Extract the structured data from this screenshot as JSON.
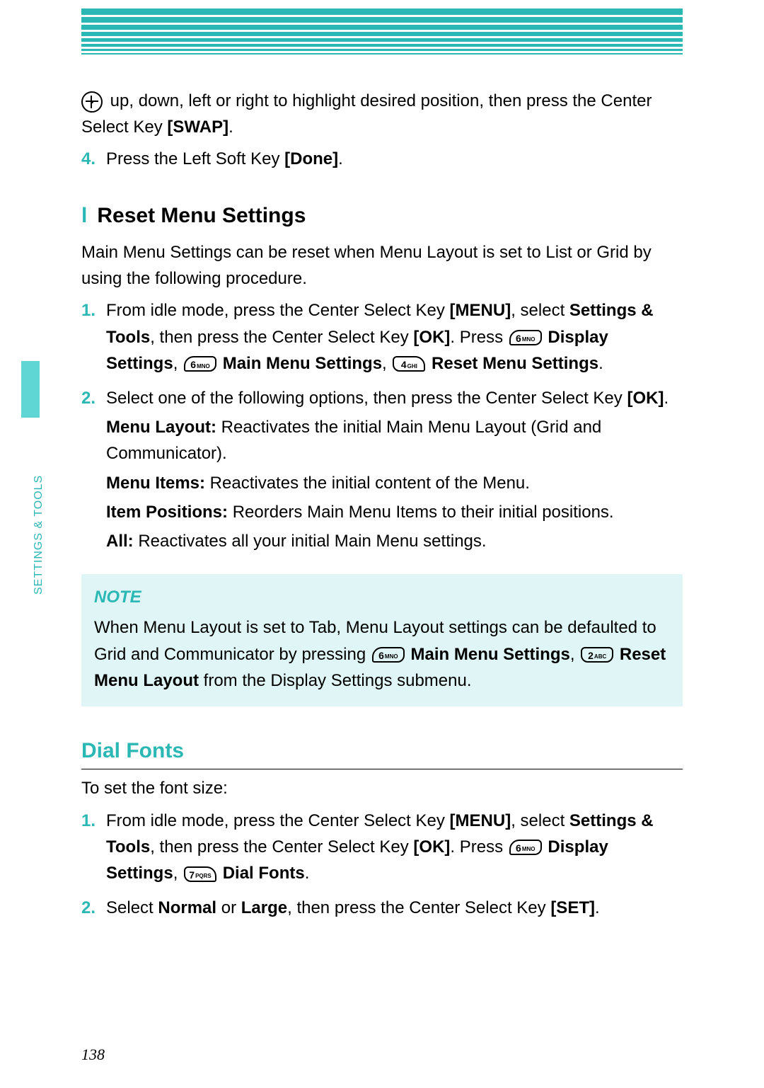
{
  "sideTab": "SETTINGS & TOOLS",
  "pageNumber": "138",
  "intro": {
    "line1a": " up, down, left or right to highlight desired position, then press the Center Select Key ",
    "swap": "[SWAP]",
    "period1": ".",
    "step4num": "4.",
    "step4a": " Press the Left Soft Key ",
    "done": "[Done]",
    "period2": "."
  },
  "reset": {
    "heading": "Reset Menu Settings",
    "intro": "Main Menu Settings can be reset when Menu Layout is set to List or Grid by using the following procedure.",
    "s1num": "1.",
    "s1a": " From idle mode, press the Center Select Key ",
    "menu": "[MENU]",
    "s1b": ", select ",
    "settingsTools": "Settings & Tools",
    "s1c": ", then press the Center Select Key ",
    "ok": "[OK]",
    "s1d": ". Press ",
    "displaySettings": " Display Settings",
    "comma": ", ",
    "mainMenuSettings": " Main Menu Settings",
    "resetMenuSettings": " Reset Menu Settings",
    "period": ".",
    "s2num": "2.",
    "s2a": " Select one of the following options, then press the Center Select Key ",
    "menuLayoutLabel": "Menu Layout:",
    "menuLayoutText": " Reactivates the initial Main Menu Layout (Grid and Communicator).",
    "menuItemsLabel": "Menu Items:",
    "menuItemsText": " Reactivates the initial content of the Menu.",
    "itemPositionsLabel": "Item Positions:",
    "itemPositionsText": " Reorders Main Menu Items to their initial positions.",
    "allLabel": "All:",
    "allText": " Reactivates all your initial Main Menu settings."
  },
  "note": {
    "title": "NOTE",
    "t1": "When Menu Layout is set to Tab, Menu Layout settings can be defaulted to Grid and Communicator by pressing ",
    "mainMenuSettings": " Main Menu Settings",
    "comma": ", ",
    "resetMenuLayout": " Reset Menu Layout",
    "t2": " from the Display Settings submenu."
  },
  "dialFonts": {
    "heading": "Dial Fonts",
    "intro": "To set the font size:",
    "s1num": "1.",
    "s1a": " From idle mode, press the Center Select Key ",
    "menu": "[MENU]",
    "s1b": ", select ",
    "settingsTools": "Settings & Tools",
    "s1c": ", then press the Center Select Key ",
    "ok": "[OK]",
    "s1d": ". Press ",
    "displaySettings": " Display Settings",
    "comma": ", ",
    "dialFonts": " Dial Fonts",
    "period": ".",
    "s2num": "2.",
    "s2a": " Select ",
    "normal": "Normal",
    "or": " or ",
    "large": "Large",
    "s2b": ", then press the Center Select Key ",
    "set": "[SET]"
  },
  "keys": {
    "k6": {
      "d": "6",
      "s": "MNO"
    },
    "k4": {
      "d": "4",
      "s": "GHI"
    },
    "k2": {
      "d": "2",
      "s": "ABC"
    },
    "k7": {
      "d": "7",
      "s": "PQRS"
    }
  }
}
